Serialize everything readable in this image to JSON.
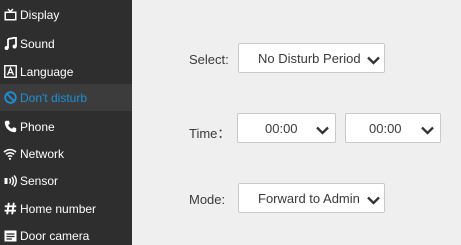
{
  "sidebar": {
    "items": [
      {
        "label": "Display",
        "icon": "tv-icon"
      },
      {
        "label": "Sound",
        "icon": "music-note-icon"
      },
      {
        "label": "Language",
        "icon": "language-icon"
      },
      {
        "label": "Don't disturb",
        "icon": "no-disturb-icon",
        "active": true
      },
      {
        "label": "Phone",
        "icon": "phone-icon"
      },
      {
        "label": "Network",
        "icon": "wifi-icon"
      },
      {
        "label": "Sensor",
        "icon": "sensor-icon"
      },
      {
        "label": "Home number",
        "icon": "hash-icon"
      },
      {
        "label": "Door camera",
        "icon": "door-camera-icon"
      }
    ]
  },
  "form": {
    "select_label": "Select:",
    "select_value": "No Disturb Period",
    "time_label": "Time：",
    "time_start": "00:00",
    "time_end": "00:00",
    "mode_label": "Mode:",
    "mode_value": "Forward to Admin"
  },
  "colors": {
    "sidebar_bg": "#2e2e2e",
    "active_accent": "#1e8fd6",
    "main_bg": "#efefef"
  }
}
